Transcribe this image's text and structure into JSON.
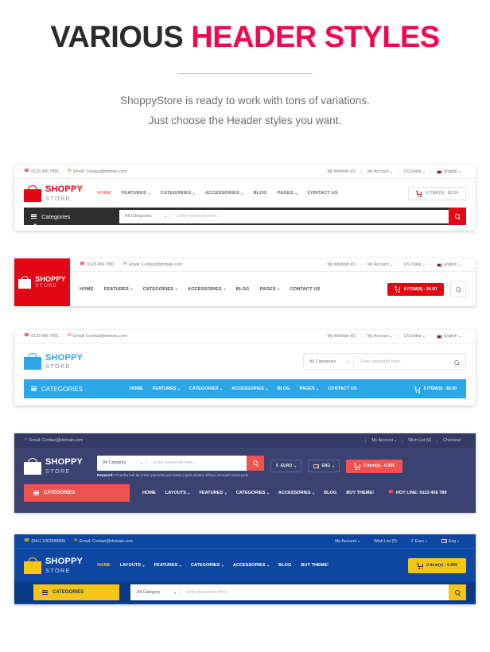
{
  "title": {
    "part1": "VARIOUS",
    "part2": "HEADER STYLES",
    "colors": {
      "dark": "#2b2b2b",
      "pink": "#f5054f"
    }
  },
  "subtitle": {
    "line1": "ShoppyStore is ready to work with tons of variations.",
    "line2": "Just choose the Header styles you want."
  },
  "common": {
    "logo": {
      "name": "SHOPPY",
      "sub": "STORE"
    },
    "phone": "0123 456 7891",
    "email": "Email: Contact@domain.com",
    "wishlist": "My Wishlish (0)",
    "account": "My Account",
    "currency_usd": "US Dollar",
    "language": "English",
    "search_placeholder": "Enter keywords here...",
    "all_categories": "All Categories",
    "all_category": "All Category",
    "cart_usd": "0 ITEM(S) - $0.00",
    "categories_lc": "Categories",
    "categories_uc": "CATEGORIES",
    "contact_us": "CONTACT US",
    "blog": "BLOG"
  },
  "header1": {
    "accent": "#e30613",
    "nav": [
      {
        "label": "HOME",
        "caret": false,
        "active": true
      },
      {
        "label": "FEATURES",
        "caret": true,
        "active": false
      },
      {
        "label": "CATEGORIES",
        "caret": true,
        "active": false
      },
      {
        "label": "ACCESSORIES",
        "caret": true,
        "active": false
      },
      {
        "label": "BLOG",
        "caret": false,
        "active": false
      },
      {
        "label": "PAGES",
        "caret": true,
        "active": false
      },
      {
        "label": "CONTACT US",
        "caret": false,
        "active": false
      }
    ]
  },
  "header2": {
    "accent": "#e30613",
    "cart": "0 ITEM(S) - $0.00",
    "nav": [
      {
        "label": "HOME",
        "caret": false
      },
      {
        "label": "FEATURES",
        "caret": true
      },
      {
        "label": "CATEGORIES",
        "caret": true
      },
      {
        "label": "ACCESSORIES",
        "caret": true
      },
      {
        "label": "BLOG",
        "caret": false
      },
      {
        "label": "PAGES",
        "caret": true
      },
      {
        "label": "CONTACT US",
        "caret": false
      }
    ]
  },
  "header3": {
    "accent": "#2ba6e8",
    "categories": "CATEGORIES",
    "cart": "0 ITEM(S) - $0.00",
    "nav": [
      {
        "label": "HOME",
        "caret": false
      },
      {
        "label": "FEATURES",
        "caret": true
      },
      {
        "label": "CATEGORIES",
        "caret": true
      },
      {
        "label": "ACCESSORIES",
        "caret": true
      },
      {
        "label": "BLOG",
        "caret": false
      },
      {
        "label": "PAGES",
        "caret": true
      },
      {
        "label": "CONTACT US",
        "caret": false
      }
    ]
  },
  "header4": {
    "bg": "#3b4272",
    "accent": "#ef5350",
    "email": "Email: Contact@domain.com",
    "account": "My Account",
    "wishlist": "Wish List (0)",
    "checkout": "Checkout",
    "search_placeholder": "Enter keywords here...",
    "all_category": "All Category",
    "keyword_label": "Keyword:",
    "keyword_text": "Picanha ball tip | Ham pancetta porchetta | Quis alcatra officia | Ground round pros",
    "currency": "EURO",
    "currency_symbol": "€",
    "language": "ENG",
    "cart": "0 item(s) - 0.00€",
    "categories": "CATEGORIES",
    "hotline": "HOT LINE: 0123 456 789",
    "nav": [
      {
        "label": "HOME",
        "caret": false
      },
      {
        "label": "LAYOUTS",
        "caret": true
      },
      {
        "label": "FEATURES",
        "caret": true
      },
      {
        "label": "CATEGORIES",
        "caret": true
      },
      {
        "label": "ACCESSORIES",
        "caret": true
      },
      {
        "label": "BLOG",
        "caret": false
      },
      {
        "label": "BUY THEME!",
        "caret": false
      }
    ]
  },
  "header5": {
    "bg": "#0d47a1",
    "accent": "#f5c518",
    "phone": "(84+) 1062999999",
    "email": "Email: Contact@domain.com",
    "account": "My Account",
    "wishlist": "Wish List (0)",
    "currency": "Euro",
    "currency_symbol": "€",
    "language": "Eng",
    "cart": "0 item(s) - 0.00€",
    "categories": "CATEGORIES",
    "all_category": "All Category",
    "search_placeholder": "Enter keywords here...",
    "nav": [
      {
        "label": "HOME",
        "caret": false,
        "active": true
      },
      {
        "label": "LAYOUTS",
        "caret": true,
        "active": false
      },
      {
        "label": "FEATURES",
        "caret": true,
        "active": false
      },
      {
        "label": "CATEGORIES",
        "caret": true,
        "active": false
      },
      {
        "label": "ACCESSORIES",
        "caret": true,
        "active": false
      },
      {
        "label": "BLOG",
        "caret": false,
        "active": false
      },
      {
        "label": "BUY THEME!",
        "caret": false,
        "active": false
      }
    ]
  }
}
